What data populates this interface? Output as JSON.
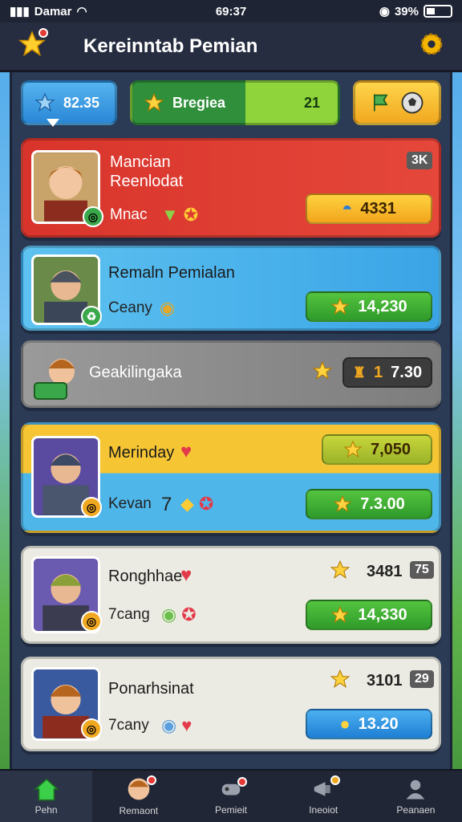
{
  "status": {
    "carrier": "Damar",
    "time": "69:37",
    "battery": "39%"
  },
  "header": {
    "title": "Kereinntab Pemian"
  },
  "topbar": {
    "stars_value": "82.35",
    "progress_label": "Bregiea",
    "progress_value": "21",
    "progress_fraction": 0.55
  },
  "entries": [
    {
      "name_line1": "Mancian",
      "name_line2": "Reenlodat",
      "sub": "Mnac",
      "score": "4331",
      "tag": "3K",
      "color": "#e03a32"
    },
    {
      "name_line1": "Remaln Pemialan",
      "sub": "Ceany",
      "score": "14,230",
      "color": "#4fb6ea"
    },
    {
      "name_line1": "Geakilingaka",
      "rank": "1",
      "score": "7.30",
      "color": "#8a8a8a"
    },
    {
      "name_line1": "Merinday",
      "sub": "Kevan",
      "sub_num": "7",
      "score_top": "7,050",
      "score": "7.3.00",
      "color": "#f6c534"
    },
    {
      "name_line1": "Ronghhae",
      "sub": "7cang",
      "score_plain": "3481",
      "tag": "75",
      "score": "14,330",
      "color": "#ecebe3"
    },
    {
      "name_line1": "Ponarhsinat",
      "sub": "7cany",
      "score_plain": "3101",
      "tag": "29",
      "score": "13.20",
      "color": "#ecebe3"
    }
  ],
  "nav": [
    {
      "label": "Pehn",
      "icon": "home-icon"
    },
    {
      "label": "Remaont",
      "icon": "avatar-icon"
    },
    {
      "label": "Pemieit",
      "icon": "controller-icon"
    },
    {
      "label": "Ineoiot",
      "icon": "megaphone-icon"
    },
    {
      "label": "Peanaen",
      "icon": "profile-icon"
    }
  ]
}
